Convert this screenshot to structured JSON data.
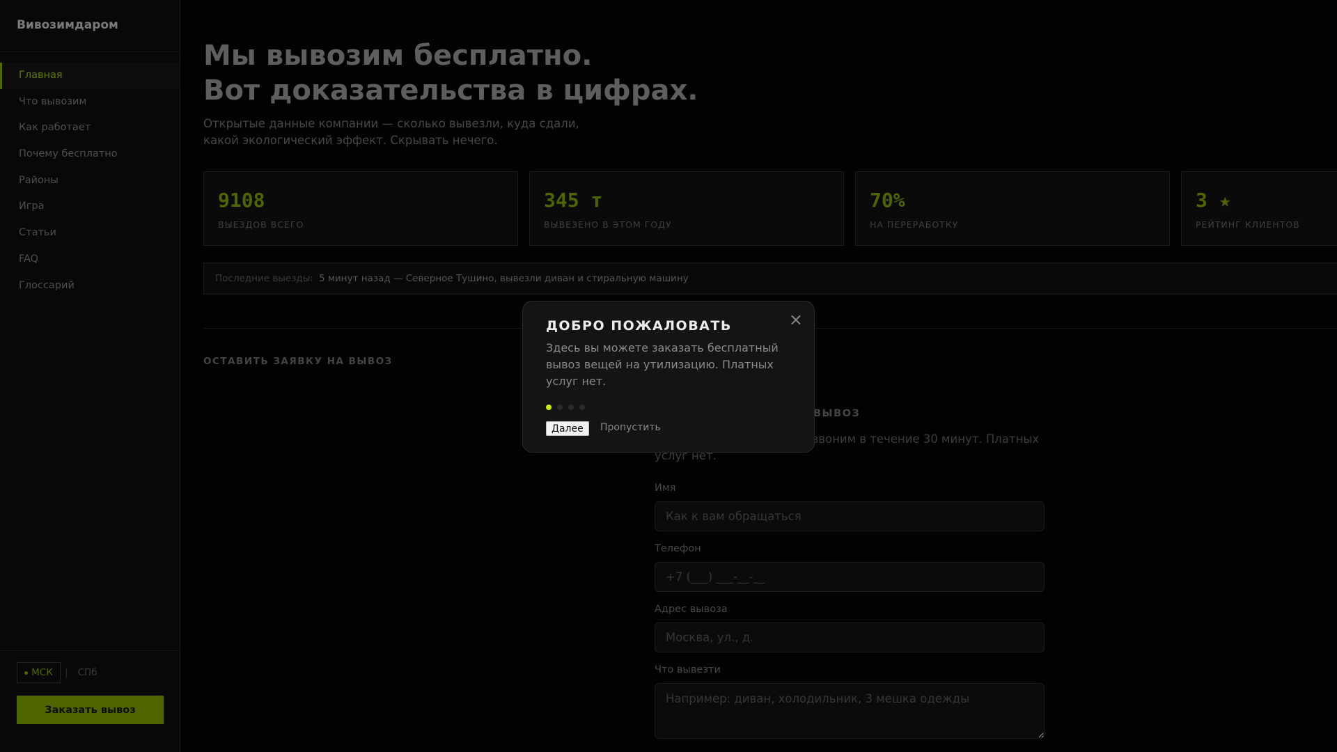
{
  "sidebar": {
    "logo": "Вивозимдаром",
    "nav": [
      "Главная",
      "Что вывозим",
      "Как работает",
      "Почему бесплатно",
      "Районы",
      "Игра",
      "Статьи",
      "FAQ",
      "Глоссарий"
    ],
    "cities": {
      "active": "МСК",
      "other": "СПб",
      "separator": "|"
    },
    "order_button": "Заказать вывоз"
  },
  "hero": {
    "title_line1": "Мы вывозим бесплатно.",
    "title_line2": "Вот доказательства в цифрах.",
    "subtitle": "Открытые данные компании — сколько вывезли, куда сдали, какой экологический эффект. Скрывать нечего."
  },
  "stats": [
    {
      "value": "9108",
      "label": "ВЫЕЗДОВ ВСЕГО"
    },
    {
      "value": "345 т",
      "label": "ВЫВЕЗЕНО В ЭТОМ ГОДУ"
    },
    {
      "value": "70%",
      "label": "НА ПЕРЕРАБОТКУ"
    },
    {
      "value": "3 ★",
      "label": "РЕЙТИНГ КЛИЕНТОВ"
    }
  ],
  "ticker": {
    "label": "Последние выезды:",
    "text": "5 минут назад — Северное Тушино, вывезли диван и стиральную машину"
  },
  "section_title": "ОСТАВИТЬ ЗАЯВКУ НА ВЫВОЗ",
  "form": {
    "heading": "ВЫВОЗ",
    "description": "…звоним в течение 30 минут. Платных услуг нет.",
    "fields": [
      {
        "label": "Имя",
        "placeholder": "Как к вам обращаться"
      },
      {
        "label": "Телефон",
        "placeholder": "+7 (___) ___-__-__"
      },
      {
        "label": "Адрес вывоза",
        "placeholder": "Москва, ул., д."
      },
      {
        "label": "Что вывезти",
        "placeholder": "Например: диван, холодильник, 3 мешка одежды"
      }
    ]
  },
  "modal": {
    "title": "ДОБРО ПОЖАЛОВАТЬ",
    "body": "Здесь вы можете заказать бесплатный вывоз вещей на утилизацию. Платных услуг нет.",
    "close": "×",
    "step": 1,
    "steps_total": 4,
    "next": "Далее",
    "skip": "Пропустить"
  },
  "colors": {
    "accent": "#4f6600",
    "active_dot": "#c8f000"
  }
}
